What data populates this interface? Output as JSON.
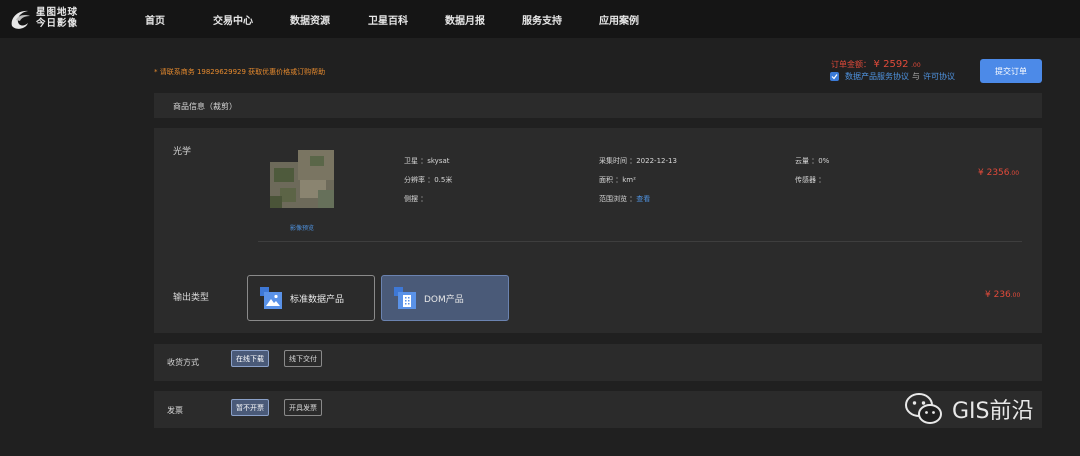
{
  "brand": {
    "line1": "星图地球",
    "line2": "今日影像"
  },
  "nav": {
    "items": [
      {
        "label": "首页"
      },
      {
        "label": "交易中心"
      },
      {
        "label": "数据资源"
      },
      {
        "label": "卫星百科"
      },
      {
        "label": "数据月报"
      },
      {
        "label": "服务支持"
      },
      {
        "label": "应用案例"
      }
    ]
  },
  "order": {
    "tip": "* 请联系商务 19829629929 获取优惠价格或订购帮助",
    "total_label": "订单金额：",
    "total_amount": "¥ 2592",
    "total_cents": ".00",
    "agree_text": "数据产品服务协议",
    "agree_sep": "与",
    "license_text": "许可协议",
    "submit_label": "提交订单"
  },
  "product_info": {
    "title": "商品信息（裁剪）"
  },
  "optical": {
    "label": "光学",
    "preview_label": "影像预览",
    "satellite": "卫星 ：skysat",
    "capture_time": "采集时间 ：2022-12-13",
    "cloud": "云量 ：0%",
    "resolution": "分辨率 ：0.5米",
    "area": "面积 ：km²",
    "sensor": "传感器 ：",
    "side_view": "侧摆 ：",
    "range_label": "范围浏览 ：",
    "range_link": "查看",
    "price_amount": "¥ 2356",
    "price_cents": ".00"
  },
  "output": {
    "label": "输出类型",
    "options": [
      {
        "label": "标准数据产品"
      },
      {
        "label": "DOM产品"
      }
    ],
    "price_amount": "¥ 236",
    "price_cents": ".00"
  },
  "delivery": {
    "label": "收货方式",
    "options": [
      {
        "label": "在线下载"
      },
      {
        "label": "线下交付"
      }
    ]
  },
  "invoice": {
    "label": "发票",
    "options": [
      {
        "label": "暂不开票"
      },
      {
        "label": "开具发票"
      }
    ]
  },
  "watermark": {
    "text": "GIS前沿"
  },
  "colors": {
    "accent": "#4c8ae8",
    "price": "#e04a3a",
    "tip": "#e68a2e",
    "selected": "#4a5a78"
  }
}
